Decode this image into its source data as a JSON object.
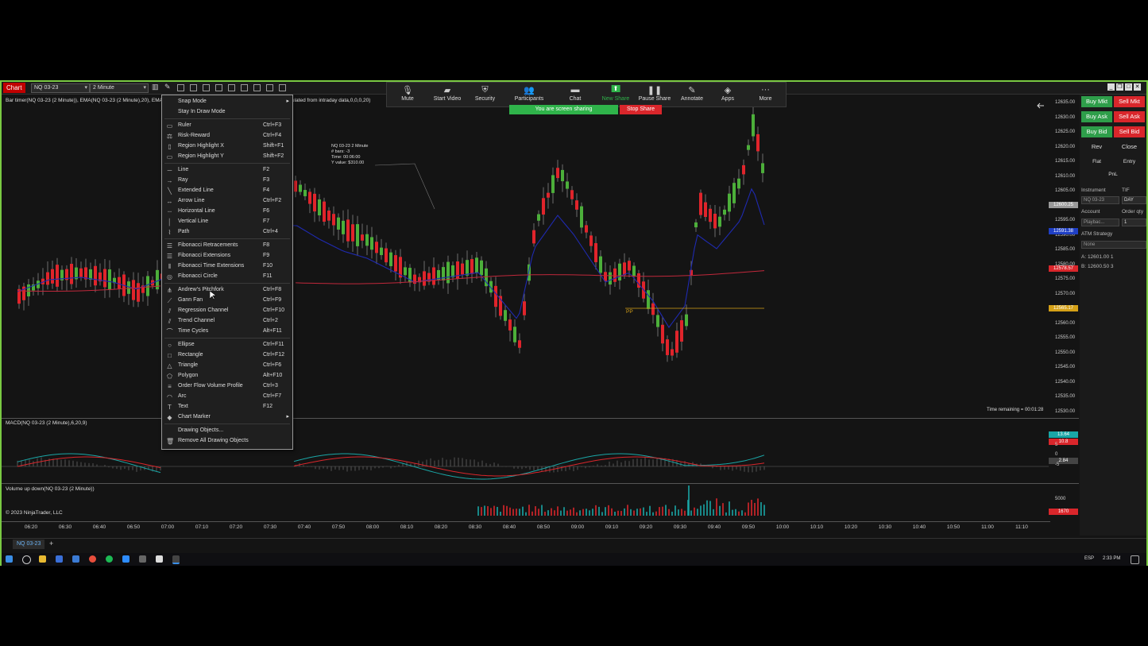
{
  "toolbar": {
    "chart_label": "Chart",
    "instrument": "NQ 03-23",
    "interval": "2 Minute"
  },
  "indicator_line": {
    "left": "Bar timer(NQ 03-23 (2 Minute)), EMA(NQ 03-23 (2 Minute),20), EMA(NQ",
    "right": "ulated from intraday data,0,0,0,20)"
  },
  "zoom": {
    "items": [
      {
        "label": "Mute",
        "icon": "microphone-icon"
      },
      {
        "label": "Start Video",
        "icon": "video-icon"
      },
      {
        "label": "Security",
        "icon": "shield-icon"
      },
      {
        "label": "Participants",
        "icon": "people-icon",
        "count": "1"
      },
      {
        "label": "Chat",
        "icon": "chat-icon"
      },
      {
        "label": "New Share",
        "icon": "share-icon"
      },
      {
        "label": "Pause Share",
        "icon": "pause-icon"
      },
      {
        "label": "Annotate",
        "icon": "pen-icon"
      },
      {
        "label": "Apps",
        "icon": "apps-icon"
      },
      {
        "label": "More",
        "icon": "more-icon"
      }
    ],
    "sharing_text": "You are screen sharing",
    "stop_share": "Stop Share"
  },
  "menu": {
    "items": [
      {
        "label": "Snap Mode",
        "shortcut": "",
        "submenu": true,
        "icon": ""
      },
      {
        "label": "Stay In Draw Mode",
        "shortcut": "",
        "icon": ""
      },
      {
        "label": "Ruler",
        "shortcut": "Ctrl+F3",
        "icon": "ruler-icon"
      },
      {
        "label": "Risk-Reward",
        "shortcut": "Ctrl+F4",
        "icon": "risk-reward-icon"
      },
      {
        "label": "Region Highlight X",
        "shortcut": "Shift+F1",
        "icon": "region-x-icon"
      },
      {
        "label": "Region Highlight Y",
        "shortcut": "Shift+F2",
        "icon": "region-y-icon"
      },
      {
        "label": "Line",
        "shortcut": "F2",
        "icon": "line-icon"
      },
      {
        "label": "Ray",
        "shortcut": "F3",
        "icon": "ray-icon"
      },
      {
        "label": "Extended Line",
        "shortcut": "F4",
        "icon": "extended-line-icon"
      },
      {
        "label": "Arrow Line",
        "shortcut": "Ctrl+F2",
        "icon": "arrow-line-icon"
      },
      {
        "label": "Horizontal Line",
        "shortcut": "F6",
        "icon": "horizontal-line-icon"
      },
      {
        "label": "Vertical Line",
        "shortcut": "F7",
        "icon": "vertical-line-icon"
      },
      {
        "label": "Path",
        "shortcut": "Ctrl+4",
        "icon": "path-icon"
      },
      {
        "label": "Fibonacci Retracements",
        "shortcut": "F8",
        "icon": "fib-retracement-icon"
      },
      {
        "label": "Fibonacci Extensions",
        "shortcut": "F9",
        "icon": "fib-extension-icon"
      },
      {
        "label": "Fibonacci Time Extensions",
        "shortcut": "F10",
        "icon": "fib-time-icon"
      },
      {
        "label": "Fibonacci Circle",
        "shortcut": "F11",
        "icon": "fib-circle-icon"
      },
      {
        "label": "Andrew's Pitchfork",
        "shortcut": "Ctrl+F8",
        "icon": "pitchfork-icon"
      },
      {
        "label": "Gann Fan",
        "shortcut": "Ctrl+F9",
        "icon": "gann-fan-icon"
      },
      {
        "label": "Regression Channel",
        "shortcut": "Ctrl+F10",
        "icon": "regression-icon"
      },
      {
        "label": "Trend Channel",
        "shortcut": "Ctrl+2",
        "icon": "trend-channel-icon"
      },
      {
        "label": "Time Cycles",
        "shortcut": "Alt+F11",
        "icon": "time-cycles-icon"
      },
      {
        "label": "Ellipse",
        "shortcut": "Ctrl+F11",
        "icon": "ellipse-icon"
      },
      {
        "label": "Rectangle",
        "shortcut": "Ctrl+F12",
        "icon": "rectangle-icon"
      },
      {
        "label": "Triangle",
        "shortcut": "Ctrl+F6",
        "icon": "triangle-icon"
      },
      {
        "label": "Polygon",
        "shortcut": "Alt+F10",
        "icon": "polygon-icon"
      },
      {
        "label": "Order Flow Volume Profile",
        "shortcut": "Ctrl+3",
        "icon": "volume-profile-icon"
      },
      {
        "label": "Arc",
        "shortcut": "Ctrl+F7",
        "icon": "arc-icon"
      },
      {
        "label": "Text",
        "shortcut": "F12",
        "icon": "text-icon"
      },
      {
        "label": "Chart Marker",
        "shortcut": "",
        "submenu": true,
        "icon": "marker-icon"
      },
      {
        "label": "Drawing Objects...",
        "shortcut": "",
        "icon": ""
      },
      {
        "label": "Remove All Drawing Objects",
        "shortcut": "",
        "icon": "trash-icon"
      }
    ]
  },
  "tooltip": {
    "title": "NQ 03-23 2 Minute",
    "bars": "# bars:    -3",
    "time": "Time:     00:06:00",
    "yvalue": "Y value:  $310.00"
  },
  "time_remaining": "Time remaining = 00:01:28",
  "macd_label": "MACD(NQ 03-23 (2 Minute),6,20,9)",
  "volume_label": "Volume up down(NQ 03-23 (2 Minute))",
  "copyright": "© 2023 NinjaTrader, LLC",
  "pp_label": "PP",
  "price_axis": {
    "ticks": [
      "12635.00",
      "12630.00",
      "12625.00",
      "12620.00",
      "12615.00",
      "12610.00",
      "12605.00",
      "12600.00",
      "12595.00",
      "12590.00",
      "12585.00",
      "12580.00",
      "12575.00",
      "12570.00",
      "12565.00",
      "12560.00",
      "12555.00",
      "12550.00",
      "12545.00",
      "12540.00",
      "12535.00",
      "12530.00"
    ],
    "tags": [
      {
        "text": "12600.25",
        "color": "#9a9a9a"
      },
      {
        "text": "12591.38",
        "color": "#1f3fc4"
      },
      {
        "text": "12578.57",
        "color": "#d9262b"
      },
      {
        "text": "12565.17",
        "color": "#d4a017"
      }
    ],
    "macd_tags": [
      {
        "text": "13.64",
        "color": "#1aa6a6"
      },
      {
        "text": "10.8",
        "color": "#d9262b"
      },
      {
        "text": "2.84",
        "color": "#444444"
      }
    ],
    "macd_ticks": [
      "5",
      "0",
      "-5"
    ],
    "vol_tick": "5000",
    "vol_tag": {
      "text": "1670",
      "color": "#d9262b"
    }
  },
  "time_axis": [
    "06:20",
    "06:30",
    "06:40",
    "06:50",
    "07:00",
    "07:10",
    "07:20",
    "07:30",
    "07:40",
    "07:50",
    "08:00",
    "08:10",
    "08:20",
    "08:30",
    "08:40",
    "08:50",
    "09:00",
    "09:10",
    "09:20",
    "09:30",
    "09:40",
    "09:50",
    "10:00",
    "10:10",
    "10:20",
    "10:30",
    "10:40",
    "10:50",
    "11:00",
    "11:10"
  ],
  "tab": "NQ 03-23",
  "right_panel": {
    "buy_mkt": "Buy Mkt",
    "sell_mkt": "Sell Mkt",
    "buy_ask": "Buy Ask",
    "sell_ask": "Sell Ask",
    "buy_bid": "Buy Bid",
    "sell_bid": "Sell Bid",
    "rev": "Rev",
    "close": "Close",
    "flat": "Flat",
    "entry": "Entry",
    "pnl": "PnL",
    "instrument_label": "Instrument",
    "tif_label": "TIF",
    "instrument_value": "NQ 03-23",
    "tif_value": "DAY",
    "account_label": "Account",
    "order_qty_label": "Order qty",
    "account_value": "Playbac...",
    "order_qty_value": "1",
    "atm_label": "ATM Strategy",
    "atm_value": "None",
    "ask_line": "A:  12601.00    1",
    "bid_line": "B:  12600.50    3"
  },
  "taskbar": {
    "lang": "ESP",
    "time": "2:33 PM"
  },
  "colors": {
    "frame": "#7ac943",
    "up_candle": "#4caf3a",
    "down_candle": "#e0242b",
    "ema_fast": "#1f2ab0",
    "ema_slow": "#c0283b",
    "macd": "#1aa6a6",
    "signal": "#d9262b"
  }
}
